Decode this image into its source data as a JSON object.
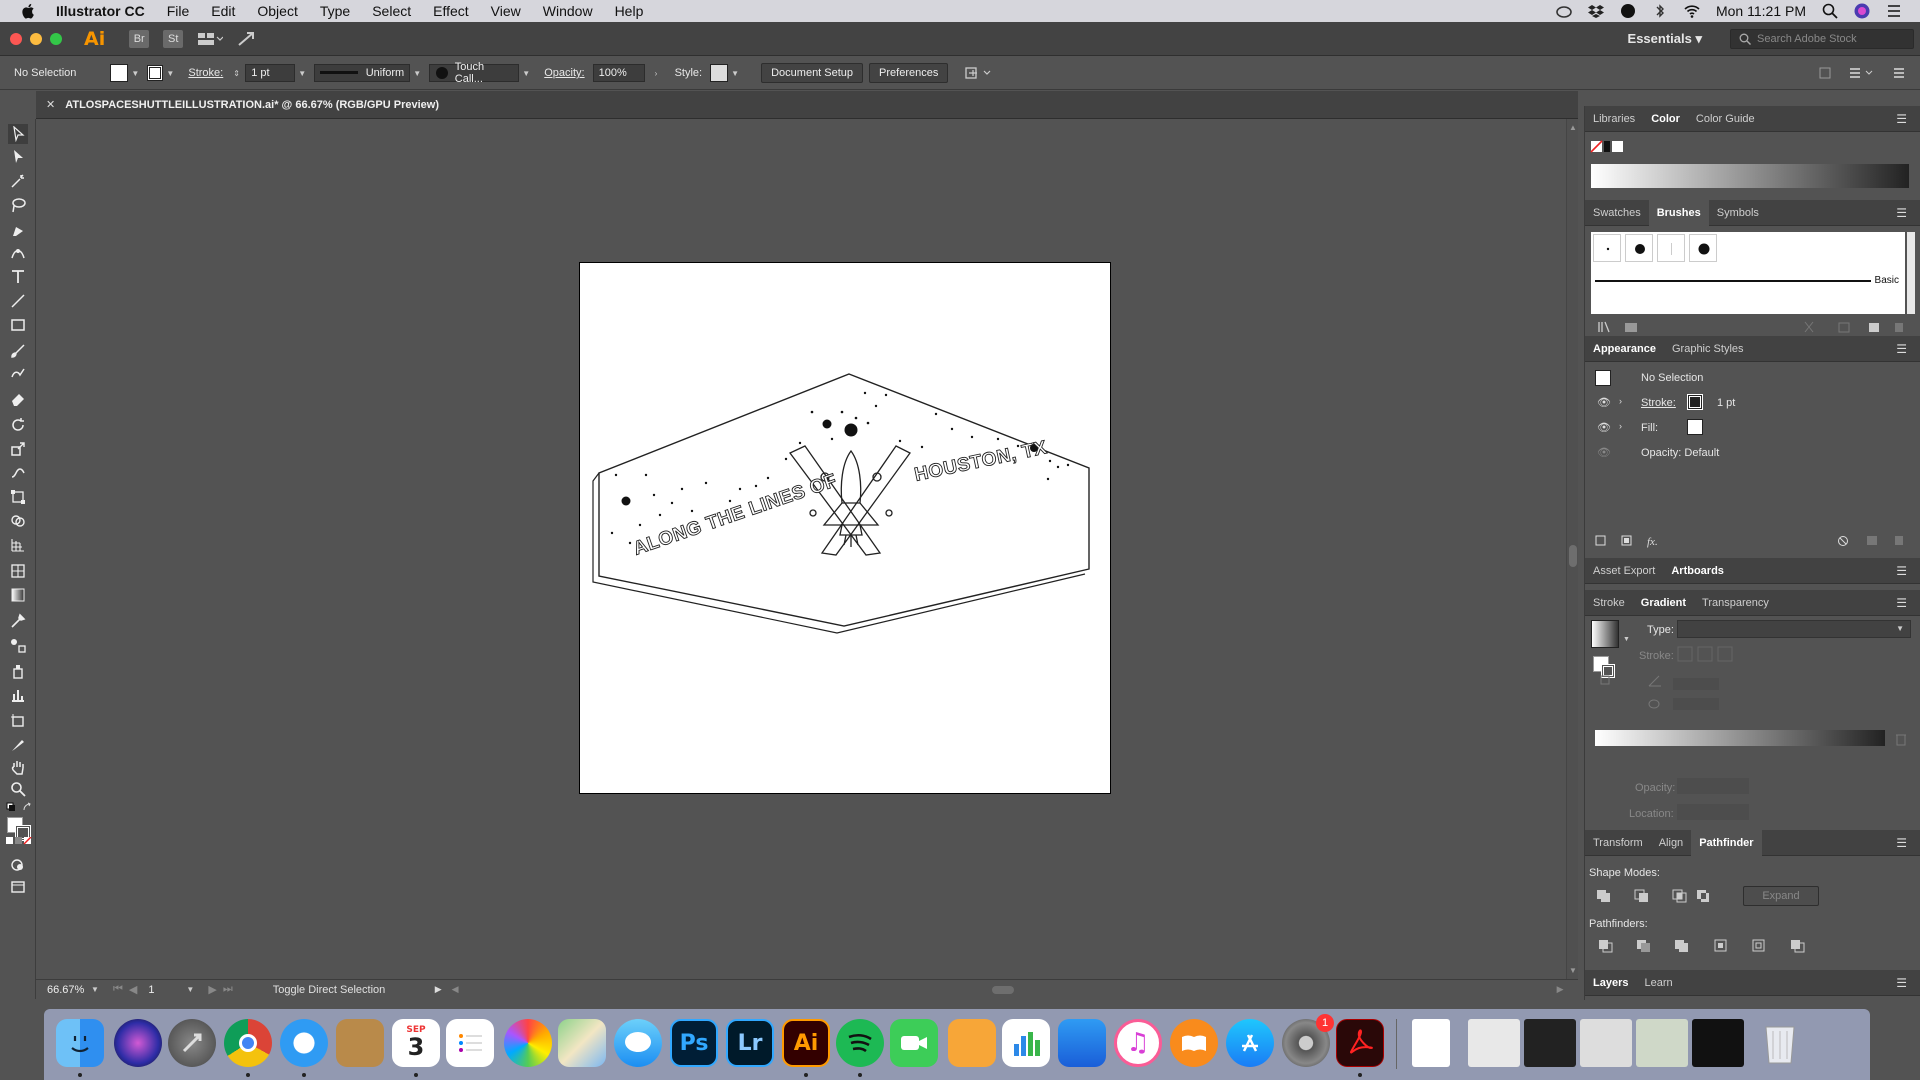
{
  "menubar": {
    "app_name": "Illustrator CC",
    "items": [
      "File",
      "Edit",
      "Object",
      "Type",
      "Select",
      "Effect",
      "View",
      "Window",
      "Help"
    ],
    "clock": "Mon 11:21 PM"
  },
  "appbar": {
    "logo": "Ai",
    "bridge": "Br",
    "stock": "St",
    "workspace": "Essentials",
    "search_placeholder": "Search Adobe Stock"
  },
  "controlbar": {
    "selection": "No Selection",
    "stroke_label": "Stroke:",
    "stroke_value": "1 pt",
    "profile": "Uniform",
    "brush": "Touch Call...",
    "opacity_label": "Opacity:",
    "opacity_value": "100%",
    "style_label": "Style:",
    "document_setup": "Document Setup",
    "preferences": "Preferences"
  },
  "document": {
    "tab_title": "ATLOSPACESHUTTLEILLUSTRATION.ai* @ 66.67% (RGB/GPU Preview)",
    "art_text_left": "ALONG THE LINES OF",
    "art_text_right": "HOUSTON, TX"
  },
  "status": {
    "zoom": "66.67%",
    "artboard_num": "1",
    "tool_hint": "Toggle Direct Selection"
  },
  "panels": {
    "color_tabs": [
      "Libraries",
      "Color",
      "Color Guide"
    ],
    "brush_tabs": [
      "Swatches",
      "Brushes",
      "Symbols"
    ],
    "brush_basic": "Basic",
    "appearance_tabs": [
      "Appearance",
      "Graphic Styles"
    ],
    "appearance_title": "No Selection",
    "stroke_label": "Stroke:",
    "stroke_value": "1 pt",
    "fill_label": "Fill:",
    "opacity_row": "Opacity: Default",
    "asset_tabs": [
      "Asset Export",
      "Artboards"
    ],
    "gradient_tabs": [
      "Stroke",
      "Gradient",
      "Transparency"
    ],
    "type_label": "Type:",
    "grad_stroke_label": "Stroke:",
    "grad_opacity_label": "Opacity:",
    "grad_location_label": "Location:",
    "transform_tabs": [
      "Transform",
      "Align",
      "Pathfinder"
    ],
    "shape_modes": "Shape Modes:",
    "expand": "Expand",
    "pathfinders": "Pathfinders:",
    "layers_tabs": [
      "Layers",
      "Learn"
    ]
  },
  "dock": {
    "calendar_month": "SEP",
    "calendar_day": "3",
    "ps": "Ps",
    "lr": "Lr",
    "ai": "Ai",
    "sysprefs_badge": "1"
  },
  "colors": {
    "ai_orange": "#f79500",
    "ui_dark": "#535353",
    "panel_tab": "#424242"
  }
}
